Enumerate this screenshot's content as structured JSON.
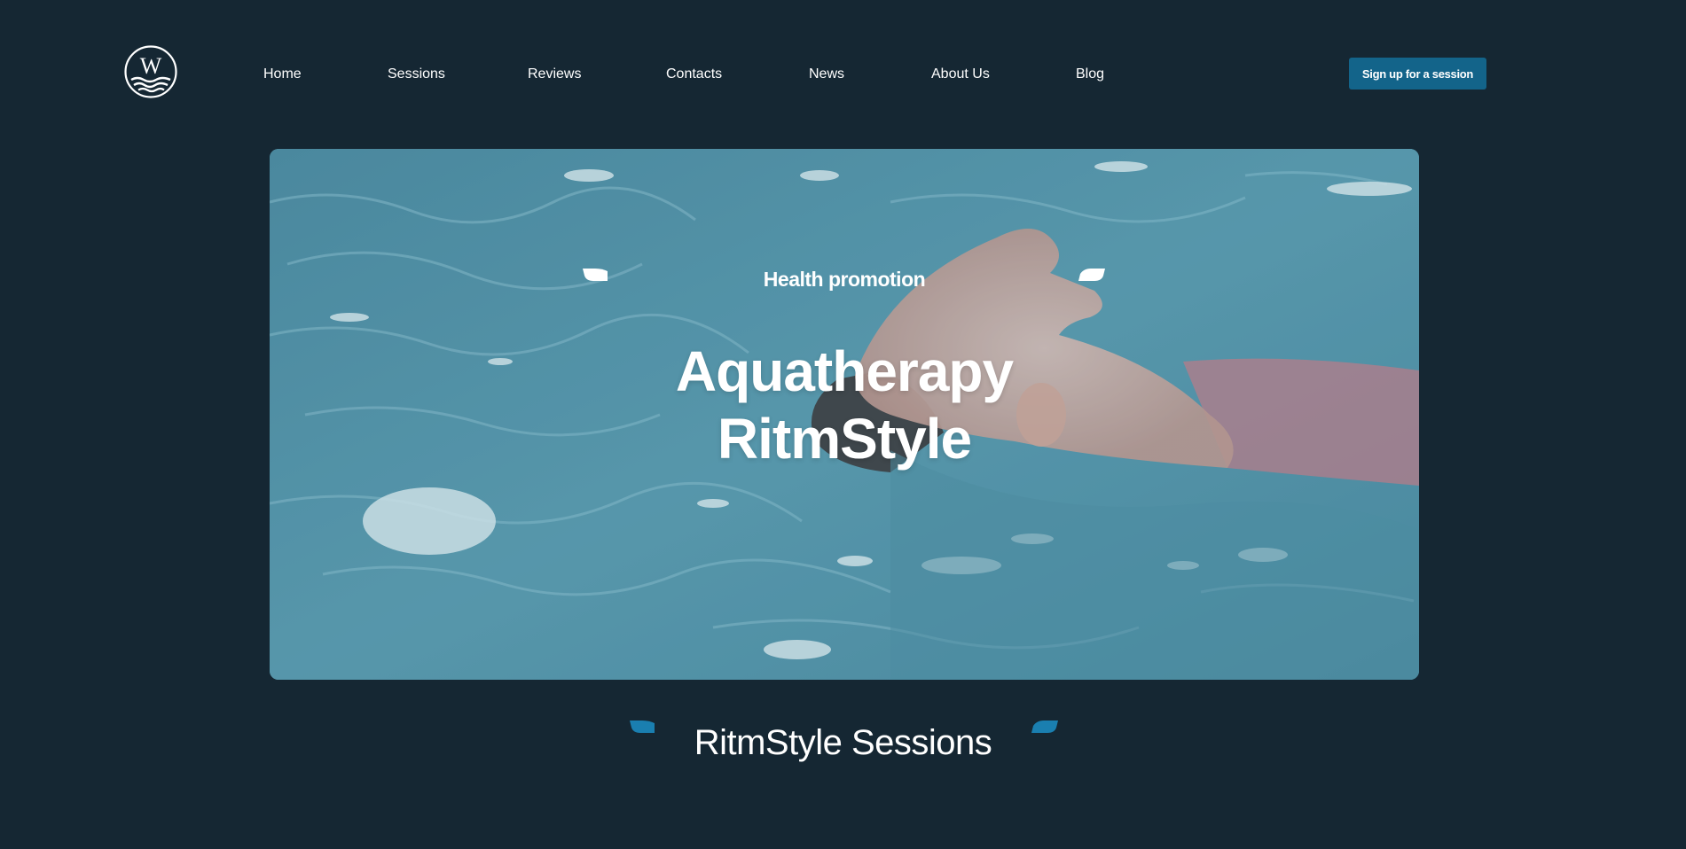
{
  "header": {
    "logo_letter": "W",
    "nav": [
      {
        "label": "Home"
      },
      {
        "label": "Sessions"
      },
      {
        "label": "Reviews"
      },
      {
        "label": "Contacts"
      },
      {
        "label": "News"
      },
      {
        "label": "About Us"
      },
      {
        "label": "Blog"
      }
    ],
    "cta_label": "Sign up for a session"
  },
  "hero": {
    "eyebrow": "Health promotion",
    "title_line1": "Aquatherapy",
    "title_line2": "RitmStyle"
  },
  "sessions": {
    "heading": "RitmStyle Sessions"
  },
  "colors": {
    "background": "#152733",
    "accent": "#13648a",
    "mark_accent": "#1a7fb0",
    "text": "#ffffff"
  },
  "icons": {
    "logo": "wave-w-logo-icon",
    "quote_marks": "comma-quote-icon"
  }
}
